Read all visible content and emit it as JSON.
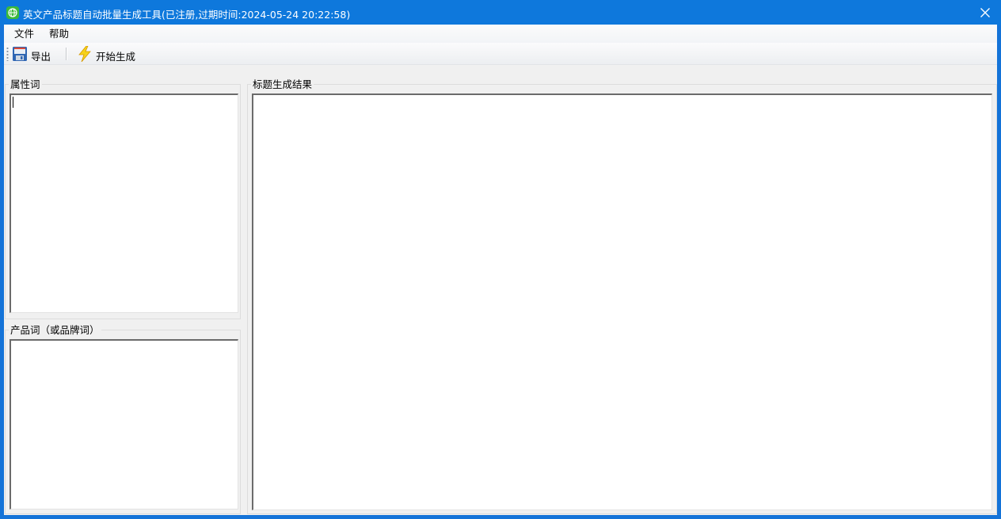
{
  "window": {
    "title": "英文产品标题自动批量生成工具(已注册,过期时间:2024-05-24 20:22:58)",
    "app_icon": "globe-icon",
    "close_icon": "close-icon",
    "accent": "#0e78dc"
  },
  "menu": {
    "items": [
      {
        "label": "文件"
      },
      {
        "label": "帮助"
      }
    ]
  },
  "toolbar": {
    "export_label": "导出",
    "export_icon": "floppy-disk-icon",
    "start_label": "开始生成",
    "start_icon": "lightning-icon"
  },
  "panels": {
    "attributes_title": "属性词",
    "attributes_value": "",
    "products_title": "产品词（或品牌词）",
    "products_value": "",
    "results_title": "标题生成结果",
    "results_value": ""
  }
}
